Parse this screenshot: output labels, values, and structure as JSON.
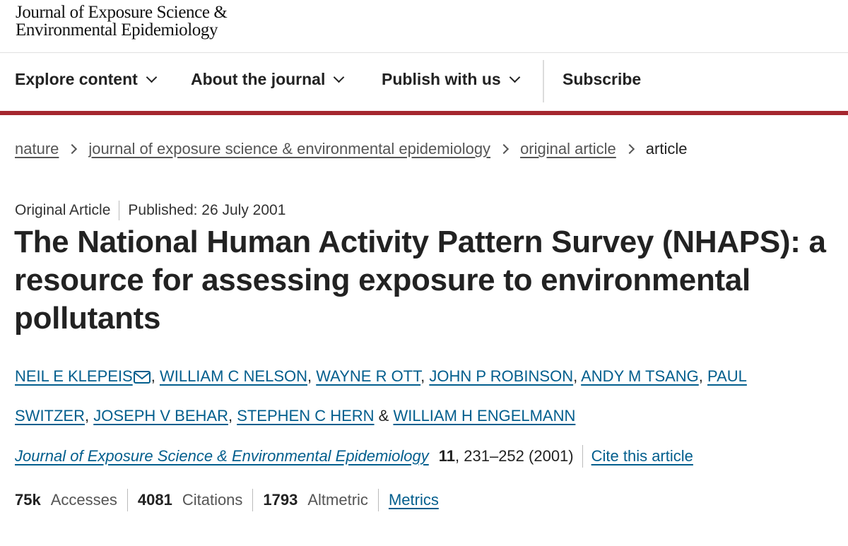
{
  "journal_logo": {
    "line1": "Journal of Exposure Science &",
    "line2": "Environmental Epidemiology"
  },
  "nav": {
    "items": [
      {
        "label": "Explore content",
        "has_dropdown": true
      },
      {
        "label": "About the journal",
        "has_dropdown": true
      },
      {
        "label": "Publish with us",
        "has_dropdown": true
      },
      {
        "label": "Subscribe",
        "has_dropdown": false
      }
    ],
    "accent_color": "#a5272f"
  },
  "breadcrumb": {
    "items": [
      "nature",
      "journal of exposure science & environmental epidemiology",
      "original article"
    ],
    "current": "article"
  },
  "article": {
    "type": "Original Article",
    "published": "Published: 26 July 2001",
    "title": "The National Human Activity Pattern Survey (NHAPS): a resource for assessing exposure to environmental pollutants",
    "authors": [
      "NEIL E KLEPEIS",
      "WILLIAM C NELSON",
      "WAYNE R OTT",
      "JOHN P ROBINSON",
      "ANDY M TSANG",
      "PAUL SWITZER",
      "JOSEPH V BEHAR",
      "STEPHEN C HERN",
      "WILLIAM H ENGELMANN"
    ],
    "author_separator": ", ",
    "author_final_separator": " & ",
    "journal_name": "Journal of Exposure Science & Environmental Epidemiology",
    "volume": "11",
    "pages_year": ", 231–252 (2001)",
    "cite_label": "Cite this article"
  },
  "metrics": {
    "accesses_value": "75k",
    "accesses_label": "Accesses",
    "citations_value": "4081",
    "citations_label": "Citations",
    "altmetric_value": "1793",
    "altmetric_label": "Altmetric",
    "metrics_link": "Metrics"
  },
  "colors": {
    "link": "#025e8d",
    "text": "#222222"
  }
}
